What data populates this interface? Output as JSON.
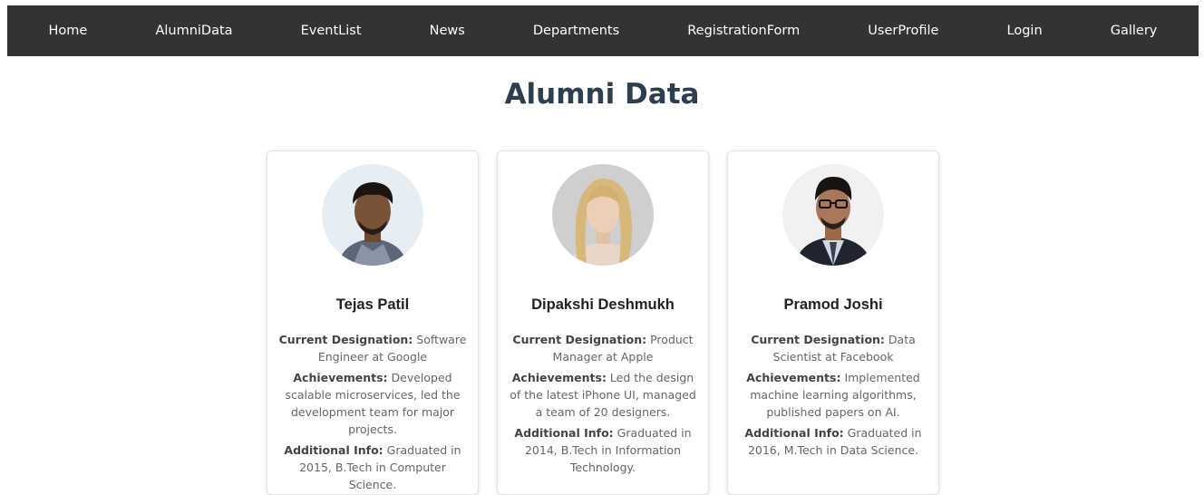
{
  "nav": {
    "items": [
      {
        "label": "Home"
      },
      {
        "label": "AlumniData"
      },
      {
        "label": "EventList"
      },
      {
        "label": "News"
      },
      {
        "label": "Departments"
      },
      {
        "label": "RegistrationForm"
      },
      {
        "label": "UserProfile"
      },
      {
        "label": "Login"
      },
      {
        "label": "Gallery"
      }
    ]
  },
  "page": {
    "title": "Alumni Data"
  },
  "labels": {
    "designation": "Current Designation:",
    "achievements": "Achievements:",
    "additional": "Additional Info:"
  },
  "alumni": [
    {
      "name": "Tejas Patil",
      "designation": "Software Engineer at Google",
      "achievements": "Developed scalable microservices, led the development team for major projects.",
      "additional": "Graduated in 2015, B.Tech in Computer Science."
    },
    {
      "name": "Dipakshi Deshmukh",
      "designation": "Product Manager at Apple",
      "achievements": "Led the design of the latest iPhone UI, managed a team of 20 designers.",
      "additional": "Graduated in 2014, B.Tech in Information Technology."
    },
    {
      "name": "Pramod Joshi",
      "designation": "Data Scientist at Facebook",
      "achievements": "Implemented machine learning algorithms, published papers on AI.",
      "additional": "Graduated in 2016, M.Tech in Data Science."
    }
  ],
  "colors": {
    "navbar_bg": "#333333",
    "title": "#2c3e50",
    "card_border": "#e3e3e3"
  },
  "icons": [
    "avatar-photo-tejas",
    "avatar-photo-dipakshi",
    "avatar-photo-pramod"
  ]
}
